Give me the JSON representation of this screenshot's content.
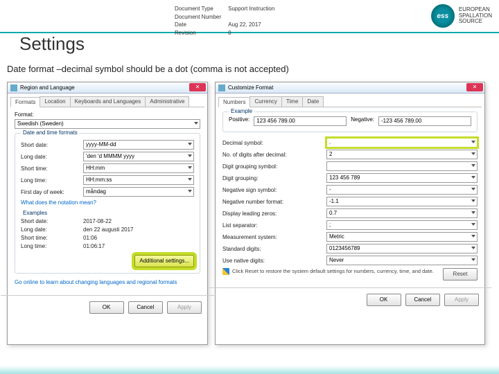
{
  "header": {
    "docTypeLabel": "Document Type",
    "docType": "Support Instruction",
    "docNumLabel": "Document Number",
    "dateLabel": "Date",
    "date": "Aug 22, 2017",
    "revLabel": "Revision",
    "rev": "0",
    "essAbbr": "ess",
    "essLine1": "EUROPEAN",
    "essLine2": "SPALLATION",
    "essLine3": "SOURCE"
  },
  "title": "Settings",
  "subtitle": "Date format –decimal symbol should be a dot (comma is not accepted)",
  "left": {
    "title": "Region and Language",
    "tabs": [
      "Formats",
      "Location",
      "Keyboards and Languages",
      "Administrative"
    ],
    "activeTab": 0,
    "formatLabel": "Format:",
    "format": "Swedish (Sweden)",
    "group1": "Date and time formats",
    "shortDateLabel": "Short date:",
    "shortDate": "yyyy-MM-dd",
    "longDateLabel": "Long date:",
    "longDate": "'den 'd MMMM yyyy",
    "shortTimeLabel": "Short time:",
    "shortTime": "HH:mm",
    "longTimeLabel": "Long time:",
    "longTime": "HH:mm:ss",
    "firstDayLabel": "First day of week:",
    "firstDay": "måndag",
    "notationLink": "What does the notation mean?",
    "group2": "Examples",
    "exShortDate": "2017-08-22",
    "exLongDate": "den 22 augusti 2017",
    "exShortTime": "01:06",
    "exLongTime": "01:06:17",
    "additionalBtn": "Additional settings...",
    "onlineLink": "Go online to learn about changing languages and regional formats",
    "ok": "OK",
    "cancel": "Cancel",
    "apply": "Apply"
  },
  "right": {
    "title": "Customize Format",
    "tabs": [
      "Numbers",
      "Currency",
      "Time",
      "Date"
    ],
    "activeTab": 0,
    "exampleLegend": "Example",
    "positiveLabel": "Positive:",
    "positive": "123 456 789.00",
    "negativeLabel": "Negative:",
    "negative": "-123 456 789.00",
    "rows": {
      "decimalSymbolLabel": "Decimal symbol:",
      "decimalSymbol": ".",
      "digitsLabel": "No. of digits after decimal:",
      "digits": "2",
      "groupSymLabel": "Digit grouping symbol:",
      "groupSym": " ",
      "groupingLabel": "Digit grouping:",
      "grouping": "123 456 789",
      "negSignLabel": "Negative sign symbol:",
      "negSign": "-",
      "negFmtLabel": "Negative number format:",
      "negFmt": "-1.1",
      "leadZeroLabel": "Display leading zeros:",
      "leadZero": "0.7",
      "listSepLabel": "List separator:",
      "listSep": ";",
      "measureLabel": "Measurement system:",
      "measure": "Metric",
      "stdDigitsLabel": "Standard digits:",
      "stdDigits": "0123456789",
      "nativeLabel": "Use native digits:",
      "native": "Never"
    },
    "noteText": "Click Reset to restore the system default settings for numbers, currency, time, and date.",
    "resetBtn": "Reset",
    "ok": "OK",
    "cancel": "Cancel",
    "apply": "Apply"
  }
}
